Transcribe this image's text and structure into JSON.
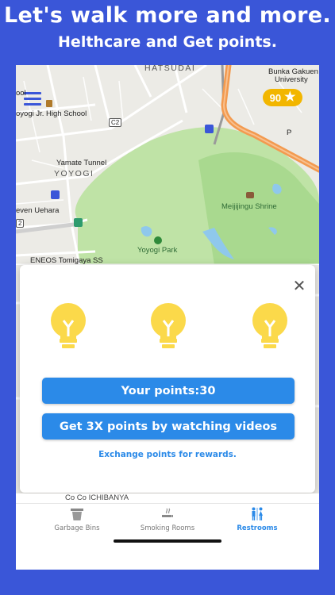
{
  "promo": {
    "title": "Let's walk more and more.",
    "subtitle": "Helthcare and Get points."
  },
  "map": {
    "labels": {
      "hatsudai": "HATSUDAI",
      "bunka": "Bunka Gakuen",
      "university": "University",
      "ool": "ool",
      "yoyogi_jr_high": "oyogi Jr. High School",
      "c2": "C2",
      "yamate_tunnel": "Yamate Tunnel",
      "yoyogi": "YOYOGI",
      "seven_uehara": "even Uehara",
      "meiji_shrine": "Meijijingu Shrine",
      "yoyogi_park": "Yoyogi Park",
      "route_2": "2",
      "eneos": "ENEOS Tomigaya SS",
      "p": "P",
      "p_right": "P",
      "coco": "Co Co ICHIBANYA"
    },
    "points_badge": {
      "value": "90",
      "icon": "star-icon",
      "color": "#f2b600"
    }
  },
  "dialog": {
    "close_icon": "close-icon",
    "bulbs": [
      "lightbulb-icon",
      "lightbulb-icon",
      "lightbulb-icon"
    ],
    "points_label": "Your points:30",
    "video_label": "Get 3X points by watching videos",
    "exchange_label": "Exchange points for rewards."
  },
  "tabs": [
    {
      "label": "Garbage Bins",
      "icon": "trash-bin-icon",
      "active": false
    },
    {
      "label": "Smoking Rooms",
      "icon": "smoking-icon",
      "active": false
    },
    {
      "label": "Restrooms",
      "icon": "restroom-icon",
      "active": true
    }
  ],
  "colors": {
    "background": "#3a56d8",
    "accent": "#2b8ae8",
    "park": "#bfe3a6",
    "water": "#8fc8ec",
    "highway": "#f39a4f",
    "bulb": "#fbd94a"
  }
}
